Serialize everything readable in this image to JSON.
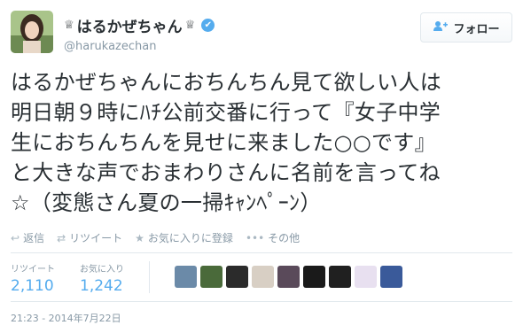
{
  "user": {
    "display_name": "はるかぜちゃん",
    "crown_left": "♕",
    "crown_right": "♕",
    "verified_icon": "verified-badge-icon",
    "handle": "@harukazechan"
  },
  "follow_button": {
    "label": "フォロー",
    "icon": "follow-person-plus-icon"
  },
  "tweet": {
    "lines": [
      "はるかぜちゃんにおちんちん見て欲しい人は",
      "明日朝９時にﾊﾁ公前交番に行って『女子中学",
      "生におちんちんを見せに来ました○○です』",
      "と大きな声でおまわりさんに名前を言ってね",
      "☆（変態さん夏の一掃ｷｬﾝﾍﾟｰﾝ）"
    ]
  },
  "actions": [
    {
      "label": "返信",
      "icon": "reply-icon"
    },
    {
      "label": "リツイート",
      "icon": "retweet-icon"
    },
    {
      "label": "お気に入りに登録",
      "icon": "favorite-star-icon"
    },
    {
      "label": "その他",
      "icon": "more-dots-icon"
    }
  ],
  "stats": {
    "retweets": {
      "label": "リツイート",
      "value": "2,110"
    },
    "favorites": {
      "label": "お気に入り",
      "value": "1,242"
    }
  },
  "favoriters_colors": [
    "#6b8aa8",
    "#4a6a3a",
    "#2b2b2b",
    "#d8cfc4",
    "#5a4a5a",
    "#1a1a1a",
    "#202020",
    "#e8e0f0",
    "#3a5a9a"
  ],
  "timestamp": "21:23 - 2014年7月22日",
  "colors": {
    "accent": "#55acee",
    "text": "#292f33",
    "muted": "#8899a6",
    "border": "#e1e8ed"
  }
}
